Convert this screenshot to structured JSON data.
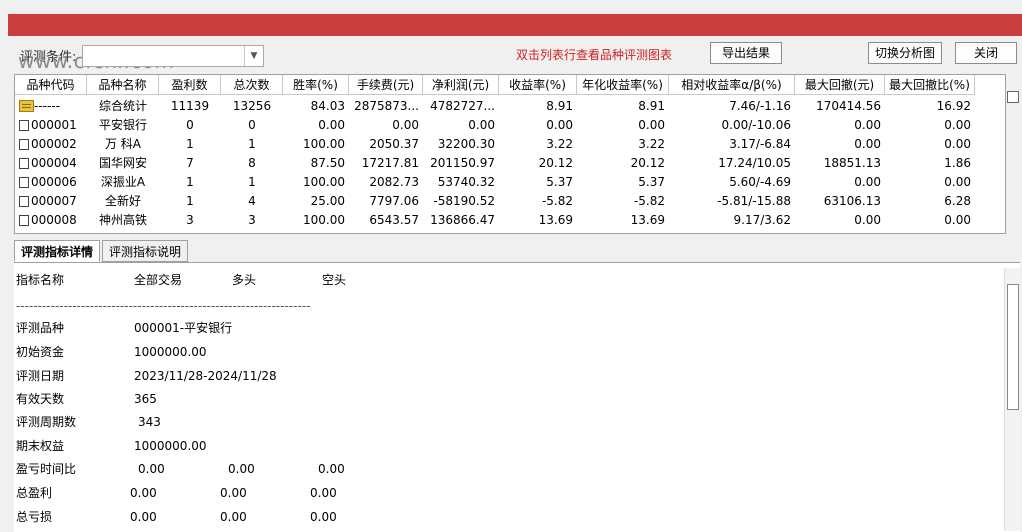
{
  "toolbar": {
    "cond_label": "评测条件:",
    "watermark": "www.cfchi.com",
    "hint": "双击列表行查看品种评测图表",
    "export_label": "导出结果",
    "switch_label": "切换分析图",
    "close_label": "关闭"
  },
  "table": {
    "headers": [
      "品种代码",
      "品种名称",
      "盈利数",
      "总次数",
      "胜率(%)",
      "手续费(元)",
      "净利润(元)",
      "收益率(%)",
      "年化收益率(%)",
      "相对收益率α/β(%)",
      "最大回撤(元)",
      "最大回撤比(%)"
    ],
    "rows": [
      {
        "code": "------",
        "name": "综合统计",
        "win": "11139",
        "total": "13256",
        "rate": "84.03",
        "fee": "2875873...",
        "profit": "4782727...",
        "ret": "8.91",
        "annual": "8.91",
        "rel": "7.46/-1.16",
        "dd": "170414.56",
        "ddr": "16.92"
      },
      {
        "code": "000001",
        "name": "平安银行",
        "win": "0",
        "total": "0",
        "rate": "0.00",
        "fee": "0.00",
        "profit": "0.00",
        "ret": "0.00",
        "annual": "0.00",
        "rel": "0.00/-10.06",
        "dd": "0.00",
        "ddr": "0.00"
      },
      {
        "code": "000002",
        "name": "万 科A",
        "win": "1",
        "total": "1",
        "rate": "100.00",
        "fee": "2050.37",
        "profit": "32200.30",
        "ret": "3.22",
        "annual": "3.22",
        "rel": "3.17/-6.84",
        "dd": "0.00",
        "ddr": "0.00"
      },
      {
        "code": "000004",
        "name": "国华网安",
        "win": "7",
        "total": "8",
        "rate": "87.50",
        "fee": "17217.81",
        "profit": "201150.97",
        "ret": "20.12",
        "annual": "20.12",
        "rel": "17.24/10.05",
        "dd": "18851.13",
        "ddr": "1.86"
      },
      {
        "code": "000006",
        "name": "深振业A",
        "win": "1",
        "total": "1",
        "rate": "100.00",
        "fee": "2082.73",
        "profit": "53740.32",
        "ret": "5.37",
        "annual": "5.37",
        "rel": "5.60/-4.69",
        "dd": "0.00",
        "ddr": "0.00"
      },
      {
        "code": "000007",
        "name": "全新好",
        "win": "1",
        "total": "4",
        "rate": "25.00",
        "fee": "7797.06",
        "profit": "-58190.52",
        "ret": "-5.82",
        "annual": "-5.82",
        "rel": "-5.81/-15.88",
        "dd": "63106.13",
        "ddr": "6.28"
      },
      {
        "code": "000008",
        "name": "神州高铁",
        "win": "3",
        "total": "3",
        "rate": "100.00",
        "fee": "6543.57",
        "profit": "136866.47",
        "ret": "13.69",
        "annual": "13.69",
        "rel": "9.17/3.62",
        "dd": "0.00",
        "ddr": "0.00"
      }
    ]
  },
  "tabs": [
    "评测指标详情",
    "评测指标说明"
  ],
  "detail": {
    "header": {
      "label": "指标名称",
      "c1": "全部交易",
      "c2": "多头",
      "c3": "空头"
    },
    "dashes": "--------------------------------------------------------------------",
    "single": [
      {
        "label": "评测品种",
        "value": "000001-平安银行"
      },
      {
        "label": "初始资金",
        "value": "1000000.00"
      },
      {
        "label": "评测日期",
        "value": "2023/11/28-2024/11/28"
      },
      {
        "label": "有效天数",
        "value": "365"
      },
      {
        "label": "评测周期数",
        "value": "343"
      },
      {
        "label": "期末权益",
        "value": "1000000.00"
      }
    ],
    "triple": [
      {
        "label": "盈亏时间比",
        "v1": "0.00",
        "v2": "0.00",
        "v3": "0.00"
      },
      {
        "label": "总盈利",
        "v1": "0.00",
        "v2": "0.00",
        "v3": "0.00"
      },
      {
        "label": "总亏损",
        "v1": "0.00",
        "v2": "0.00",
        "v3": "0.00"
      }
    ]
  }
}
